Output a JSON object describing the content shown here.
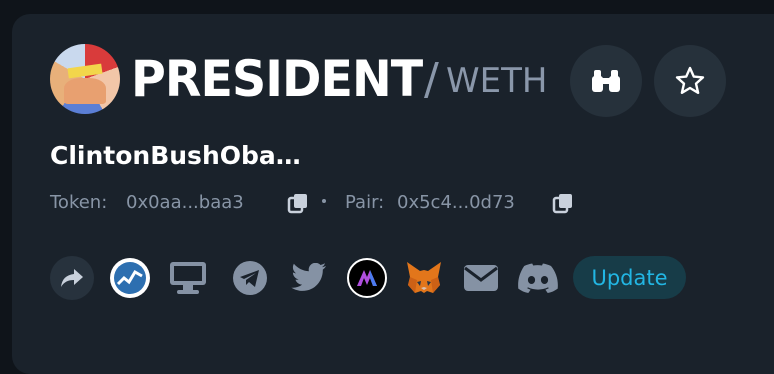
{
  "header": {
    "ticker": "PRESIDENT",
    "quote_separator": "/",
    "quote": "WETH"
  },
  "token": {
    "name": "ClintonBushOba…",
    "token_address_label": "Token:",
    "token_address": "0x0aa...baa3",
    "pair_address_label": "Pair:",
    "pair_address": "0x5c4...0d73"
  },
  "actions": {
    "update_label": "Update"
  },
  "icons": {
    "avatar": "token-avatar",
    "watch": "binoculars-icon",
    "favorite": "star-icon",
    "copy": "copy-icon",
    "social": [
      "share-icon",
      "chart-logo-icon",
      "desktop-icon",
      "telegram-icon",
      "twitter-icon",
      "dex-logo-icon",
      "metamask-icon",
      "email-icon",
      "discord-icon"
    ]
  },
  "colors": {
    "background": "#0f141a",
    "card": "#1a222b",
    "button": "#26313b",
    "muted": "#8895a6",
    "accent": "#22b6e3"
  }
}
